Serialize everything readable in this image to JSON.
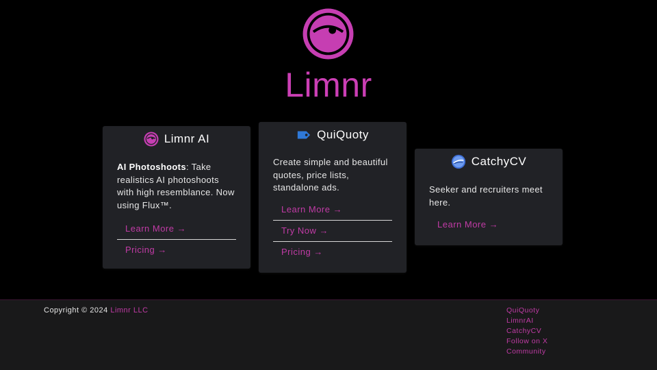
{
  "brand": {
    "name": "Limnr",
    "accent_color": "#c13ba6",
    "logo_icon": "limnr-eye-icon"
  },
  "cards": [
    {
      "title": "Limnr AI",
      "icon": "limnr-eye-icon",
      "description_bold": "AI Photoshoots",
      "description": ": Take realistics AI photoshoots with high resemblance. Now using Flux™.",
      "links": [
        "Learn More →",
        "Pricing →"
      ]
    },
    {
      "title": "QuiQuoty",
      "icon": "price-tag-icon",
      "description": "Create simple and beautiful quotes, price lists, standalone ads.",
      "links": [
        "Learn More →",
        "Try Now →",
        "Pricing →"
      ]
    },
    {
      "title": "CatchyCV",
      "icon": "catchycv-globe-icon",
      "description": "Seeker and recruiters meet here.",
      "links": [
        "Learn More →"
      ]
    }
  ],
  "footer": {
    "copyright_prefix": "Copyright © 2024",
    "company": "Limnr LLC",
    "links": [
      "QuiQuoty",
      "LimnrAI",
      "CatchyCV",
      "Follow on X",
      "Community"
    ]
  }
}
